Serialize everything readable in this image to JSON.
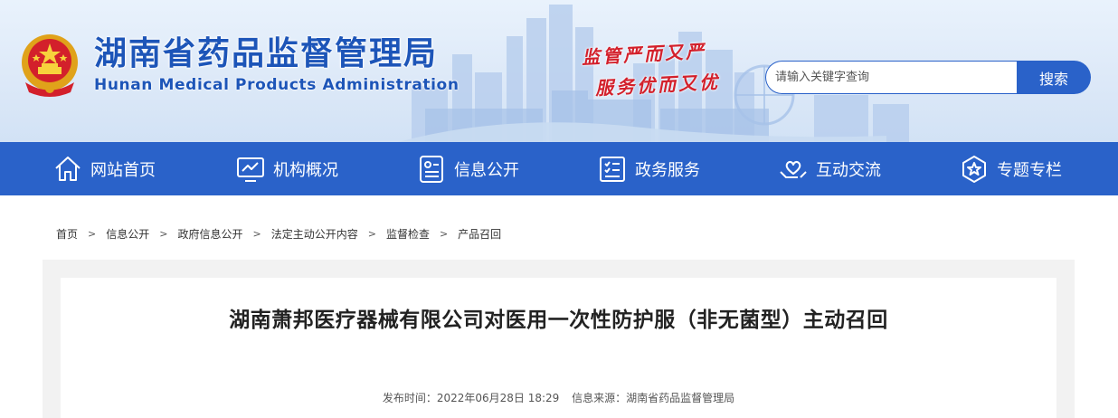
{
  "header": {
    "title": "湖南省药品监督管理局",
    "subtitle": "Hunan Medical Products Administration",
    "slogan_line1": "监管严而又严",
    "slogan_line2": "服务优而又优",
    "emblem_icon": "national-emblem-icon",
    "brand_color": "#1d55b8",
    "slogan_color": "#d3202b"
  },
  "search": {
    "placeholder": "请输入关键字查询",
    "value": "",
    "button_label": "搜索"
  },
  "nav": {
    "background": "#2a62c9",
    "items": [
      {
        "label": "网站首页",
        "icon": "home-icon"
      },
      {
        "label": "机构概况",
        "icon": "chart-monitor-icon"
      },
      {
        "label": "信息公开",
        "icon": "document-info-icon"
      },
      {
        "label": "政务服务",
        "icon": "checklist-icon"
      },
      {
        "label": "互动交流",
        "icon": "heart-hands-icon"
      },
      {
        "label": "专题专栏",
        "icon": "star-badge-icon"
      }
    ]
  },
  "breadcrumb": {
    "items": [
      "首页",
      "信息公开",
      "政府信息公开",
      "法定主动公开内容",
      "监督检查",
      "产品召回"
    ],
    "separator": ">"
  },
  "article": {
    "title": "湖南萧邦医疗器械有限公司对医用一次性防护服（非无菌型）主动召回",
    "publish_label": "发布时间：",
    "publish_time": "2022年06月28日 18:29",
    "source_label": "信息来源：",
    "source": "湖南省药品监督管理局"
  }
}
